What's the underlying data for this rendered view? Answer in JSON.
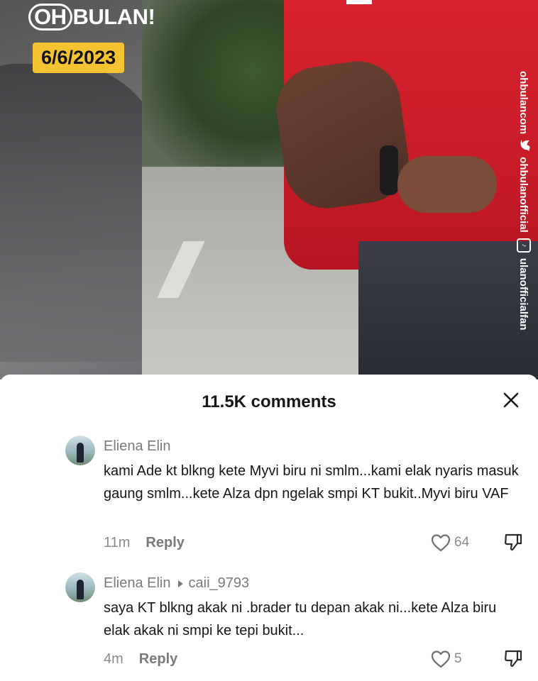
{
  "video": {
    "brand_prefix": "OH",
    "brand_suffix": "BULAN!",
    "date": "6/6/2023",
    "watermark_left": "ulanofficialfan",
    "watermark_mid": "ohbulanofficial",
    "watermark_right": "ohbulancom"
  },
  "comments_panel": {
    "title": "11.5K comments",
    "items": [
      {
        "author": "Eliena Elin",
        "reply_to": "",
        "text": "kami Ade kt blkng kete Myvi biru ni smlm...kami elak nyaris masuk gaung smlm...kete Alza dpn ngelak smpi KT bukit..Myvi biru VAF",
        "time": "11m",
        "reply_label": "Reply",
        "likes": "64"
      },
      {
        "author": "Eliena Elin",
        "reply_to": "caii_9793",
        "text": "saya KT blkng akak ni .brader tu depan akak ni...kete Alza biru elak akak ni smpi ke tepi bukit...",
        "time": "4m",
        "reply_label": "Reply",
        "likes": "5"
      }
    ]
  },
  "icons": {
    "close": "close-icon",
    "like": "heart-icon",
    "dislike": "dislike-icon"
  }
}
